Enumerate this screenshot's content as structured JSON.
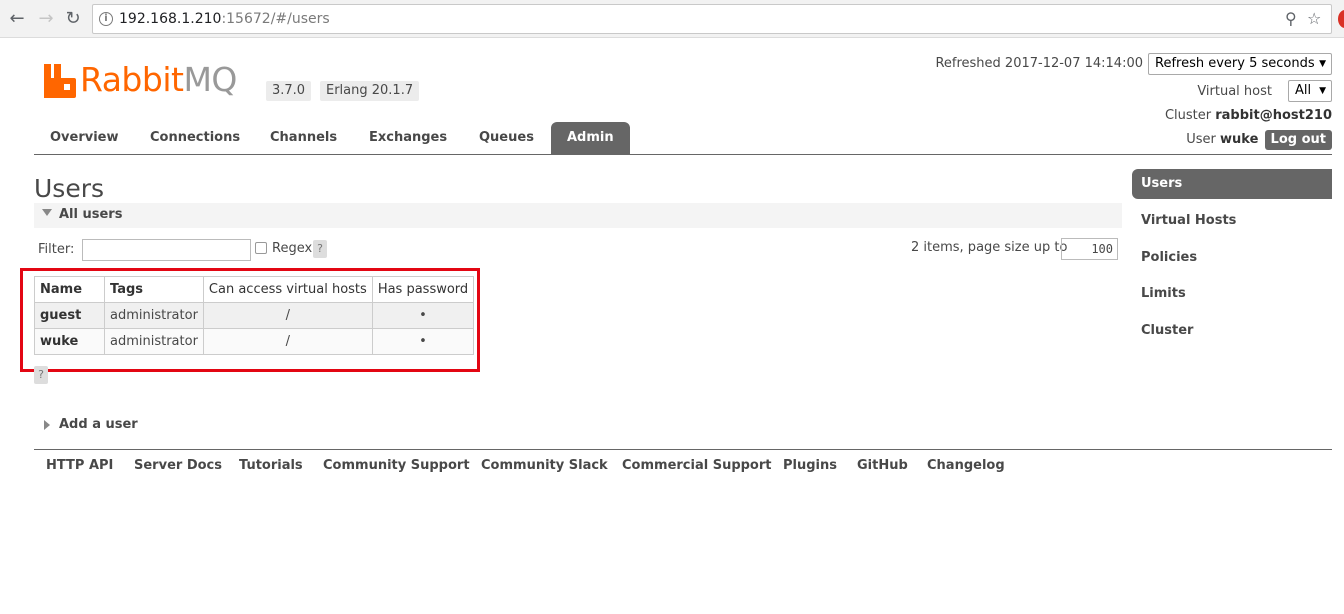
{
  "browser": {
    "url_host": "192.168.1.210",
    "url_rest": ":15672/#/users"
  },
  "header": {
    "logo_rabbit": "Rabbit",
    "logo_mq": "MQ",
    "version": "3.7.0",
    "erlang": "Erlang 20.1.7",
    "refreshed": "Refreshed 2017-12-07 14:14:00",
    "refresh_select": "Refresh every 5 seconds",
    "vhost_label": "Virtual host",
    "vhost_value": "All",
    "cluster_label": "Cluster",
    "cluster_value": "rabbit@host210",
    "user_label": "User",
    "user_value": "wuke",
    "logout": "Log out"
  },
  "tabs": [
    {
      "label": "Overview"
    },
    {
      "label": "Connections"
    },
    {
      "label": "Channels"
    },
    {
      "label": "Exchanges"
    },
    {
      "label": "Queues"
    },
    {
      "label": "Admin",
      "active": true
    }
  ],
  "main": {
    "title": "Users",
    "section_title": "All users",
    "filter_label": "Filter:",
    "filter_value": "",
    "regex_label": "Regex",
    "help": "?",
    "items_text": "2 items, page size up to",
    "page_size": "100",
    "table": {
      "headers": [
        "Name",
        "Tags",
        "Can access virtual hosts",
        "Has password"
      ],
      "rows": [
        {
          "name": "guest",
          "tags": "administrator",
          "vhosts": "/",
          "has_password": "•"
        },
        {
          "name": "wuke",
          "tags": "administrator",
          "vhosts": "/",
          "has_password": "•"
        }
      ]
    },
    "add_user": "Add a user"
  },
  "sidebar": {
    "items": [
      {
        "label": "Users",
        "active": true
      },
      {
        "label": "Virtual Hosts"
      },
      {
        "label": "Policies"
      },
      {
        "label": "Limits"
      },
      {
        "label": "Cluster"
      }
    ]
  },
  "footer": {
    "links": [
      "HTTP API",
      "Server Docs",
      "Tutorials",
      "Community Support",
      "Community Slack",
      "Commercial Support",
      "Plugins",
      "GitHub",
      "Changelog"
    ]
  },
  "colors": {
    "brand_orange": "#ff6600",
    "tab_active": "#666666",
    "highlight_red": "#e30613"
  }
}
